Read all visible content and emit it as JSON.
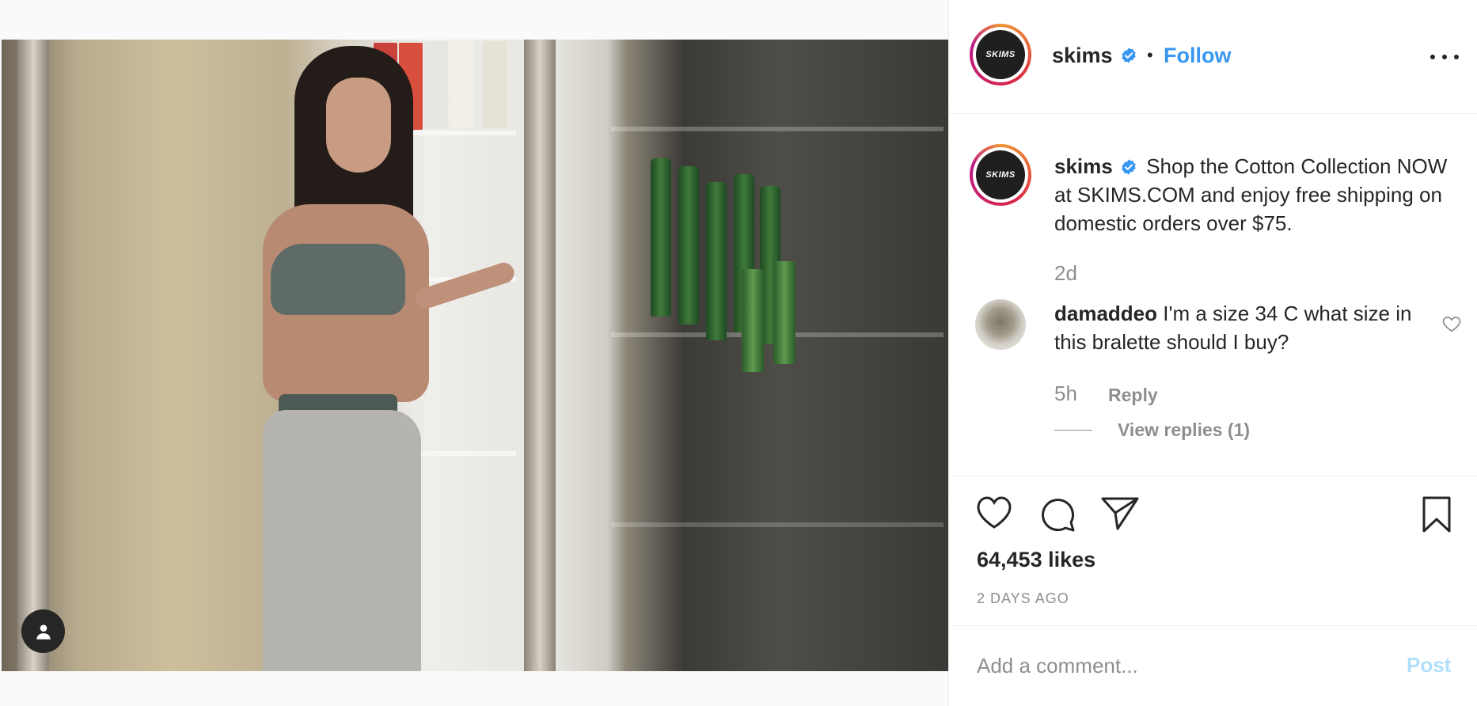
{
  "post": {
    "media": {
      "image_alt": "photo",
      "tag_icon": "user-icon"
    },
    "header": {
      "username": "skims",
      "avatar_text": "SKIMS",
      "separator": "•",
      "follow_label": "Follow",
      "more_icon": "more-options-icon"
    },
    "caption": {
      "username": "skims",
      "text": "Shop the Cotton Collection NOW at SKIMS.COM and enjoy free shipping on domestic orders over $75.",
      "time": "2d"
    },
    "comments": [
      {
        "username": "damaddeo",
        "text": "I'm a size 34 C what size in this bralette should I buy?",
        "time": "5h",
        "reply_label": "Reply",
        "view_replies_label": "View replies (1)"
      }
    ],
    "actions": {
      "like_icon": "heart-icon",
      "comment_icon": "comment-icon",
      "share_icon": "share-icon",
      "save_icon": "bookmark-icon"
    },
    "likes": "64,453 likes",
    "date": "2 DAYS AGO",
    "add_comment": {
      "placeholder": "Add a comment...",
      "post_label": "Post"
    }
  },
  "colors": {
    "accent": "#3897f0",
    "muted": "#8e8e8e",
    "text": "#262626",
    "post_disabled": "#b2dffc",
    "verified": "#3897f0"
  }
}
